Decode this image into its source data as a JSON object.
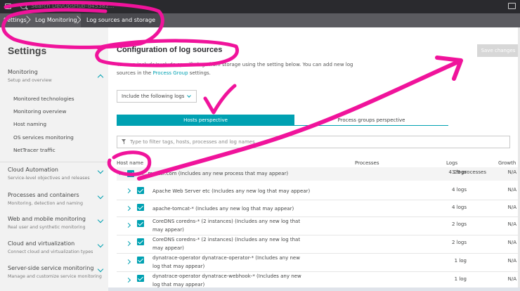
{
  "topbar": {
    "search_text": "Search DevOpsHub-d45382..."
  },
  "breadcrumb": [
    "Settings",
    "Log Monitoring",
    "Log sources and storage"
  ],
  "sidebar": {
    "title": "Settings",
    "sections": [
      {
        "title": "Monitoring",
        "subtitle": "Setup and overview",
        "expanded": true,
        "items": [
          "Monitored technologies",
          "Monitoring overview",
          "Host naming",
          "OS services monitoring",
          "NetTracer traffic"
        ]
      },
      {
        "title": "Cloud Automation",
        "subtitle": "Service-level objectives and releases"
      },
      {
        "title": "Processes and containers",
        "subtitle": "Monitoring, detection and naming"
      },
      {
        "title": "Web and mobile monitoring",
        "subtitle": "Real user and synthetic monitoring"
      },
      {
        "title": "Cloud and virtualization",
        "subtitle": "Connect cloud and virtualization types"
      },
      {
        "title": "Server-side service monitoring",
        "subtitle": "Manage and customize service monitoring"
      }
    ]
  },
  "main": {
    "title": "Configuration of log sources",
    "description_before": "You can include/exclude specific logs from storage using the setting below. You can add new log sources in the ",
    "description_link": "Process Group",
    "description_after": " settings.",
    "save_label": "Save changes",
    "dropdown_value": "Include the following logs",
    "tabs": [
      "Hosts perspective",
      "Process groups perspective"
    ],
    "filter_placeholder": "Type to filter tags, hosts, processes and log names",
    "columns": {
      "host": "Host name",
      "processes": "Processes",
      "logs": "Logs",
      "growth": "Growth"
    },
    "rows": [
      {
        "name": "......master.com (Includes any new process that may appear)",
        "processes": "29 processes",
        "logs": "43 logs",
        "growth": "N/A"
      },
      {
        "name": "Apache Web Server etc (Includes any new log that may appear)",
        "processes": "",
        "logs": "4 logs",
        "growth": "N/A"
      },
      {
        "name": "apache-tomcat-* (Includes any new log that may appear)",
        "processes": "",
        "logs": "4 logs",
        "growth": "N/A"
      },
      {
        "name": "CoreDNS coredns-* (2 instances) (Includes any new log that may appear)",
        "processes": "",
        "logs": "2 logs",
        "growth": "N/A"
      },
      {
        "name": "CoreDNS coredns-* (2 instances) (Includes any new log that may appear)",
        "processes": "",
        "logs": "2 logs",
        "growth": "N/A"
      },
      {
        "name": "dynatrace-operator dynatrace-operator-* (Includes any new log that may appear)",
        "processes": "",
        "logs": "1 log",
        "growth": "N/A"
      },
      {
        "name": "dynatrace-operator dynatrace-webhook-* (Includes any new log that may appear)",
        "processes": "",
        "logs": "1 log",
        "growth": "N/A"
      }
    ]
  },
  "annotation_color": "#f0139b"
}
